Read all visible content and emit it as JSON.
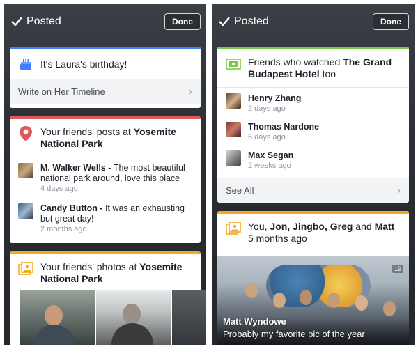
{
  "left": {
    "posted_label": "Posted",
    "done_label": "Done",
    "birthday": {
      "text": "It's Laura's birthday!",
      "action": "Write on Her Timeline"
    },
    "yosemite_posts": {
      "title_prefix": "Your friends' posts at ",
      "title_place": "Yosemite National Park",
      "posts": [
        {
          "name": "M. Walker Wells - ",
          "text": "The most beautiful national park around, love this place",
          "time": "4 days ago"
        },
        {
          "name": "Candy Button - ",
          "text": "It was an exhausting but great day!",
          "time": "2 months ago"
        }
      ]
    },
    "yosemite_photos": {
      "title_prefix": "Your friends' photos at ",
      "title_place": "Yosemite National Park"
    }
  },
  "right": {
    "posted_label": "Posted",
    "done_label": "Done",
    "movie": {
      "title_prefix": "Friends who watched ",
      "title_movie": "The Grand Budapest Hotel",
      "title_suffix": " too",
      "friends": [
        {
          "name": "Henry Zhang",
          "time": "2 days ago"
        },
        {
          "name": "Thomas Nardone",
          "time": "5 days ago"
        },
        {
          "name": "Max Segan",
          "time": "2 weeks ago"
        }
      ],
      "see_all": "See All"
    },
    "tagged": {
      "you": "You, ",
      "names": "Jon, Jingbo, Greg",
      "and": " and ",
      "last": "Matt",
      "time": "5 months ago",
      "photo_name": "Matt Wyndowe",
      "photo_caption": "Probably my favorite pic of the year",
      "photo_counter": "19"
    }
  },
  "colors": {
    "blue_stripe": "#4080ff",
    "red_stripe": "#e0585c",
    "orange_stripe": "#f5a623",
    "green_stripe": "#7ac943"
  }
}
